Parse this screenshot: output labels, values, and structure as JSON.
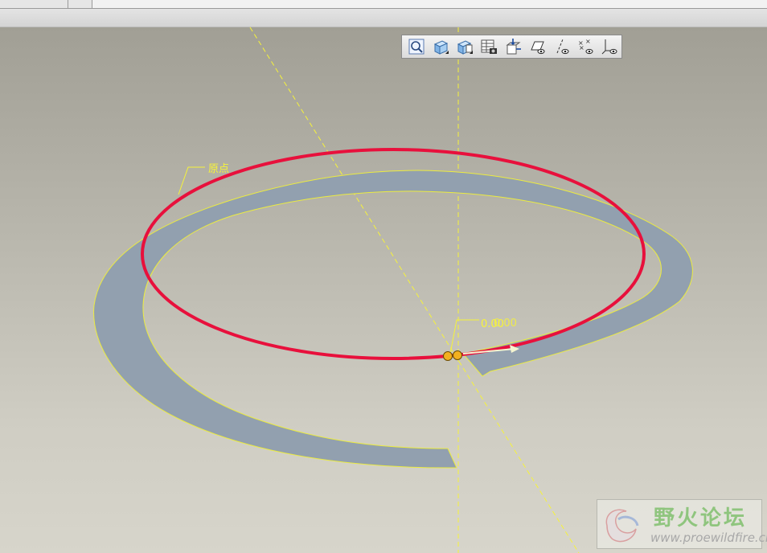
{
  "labels": {
    "origin": "原点",
    "dim_a": "0.00",
    "dim_b": "0.00"
  },
  "toolbar": {
    "buttons": [
      {
        "name": "zoom-icon"
      },
      {
        "name": "view-orient-icon"
      },
      {
        "name": "named-views-icon"
      },
      {
        "name": "layer-table-icon"
      },
      {
        "name": "repaint-icon"
      },
      {
        "name": "datum-plane-display-icon"
      },
      {
        "name": "datum-axis-display-icon"
      },
      {
        "name": "datum-point-display-icon"
      },
      {
        "name": "coordinate-system-display-icon"
      }
    ]
  },
  "watermark": {
    "title": "野火论坛",
    "url": "www.proewildfire.cn"
  },
  "colors": {
    "highlight": "#e8103c",
    "datum_yellow": "#f6f33a",
    "part_fill": "#92a0af",
    "background_top": "#a19f95",
    "background_bottom": "#d7d5cb"
  }
}
